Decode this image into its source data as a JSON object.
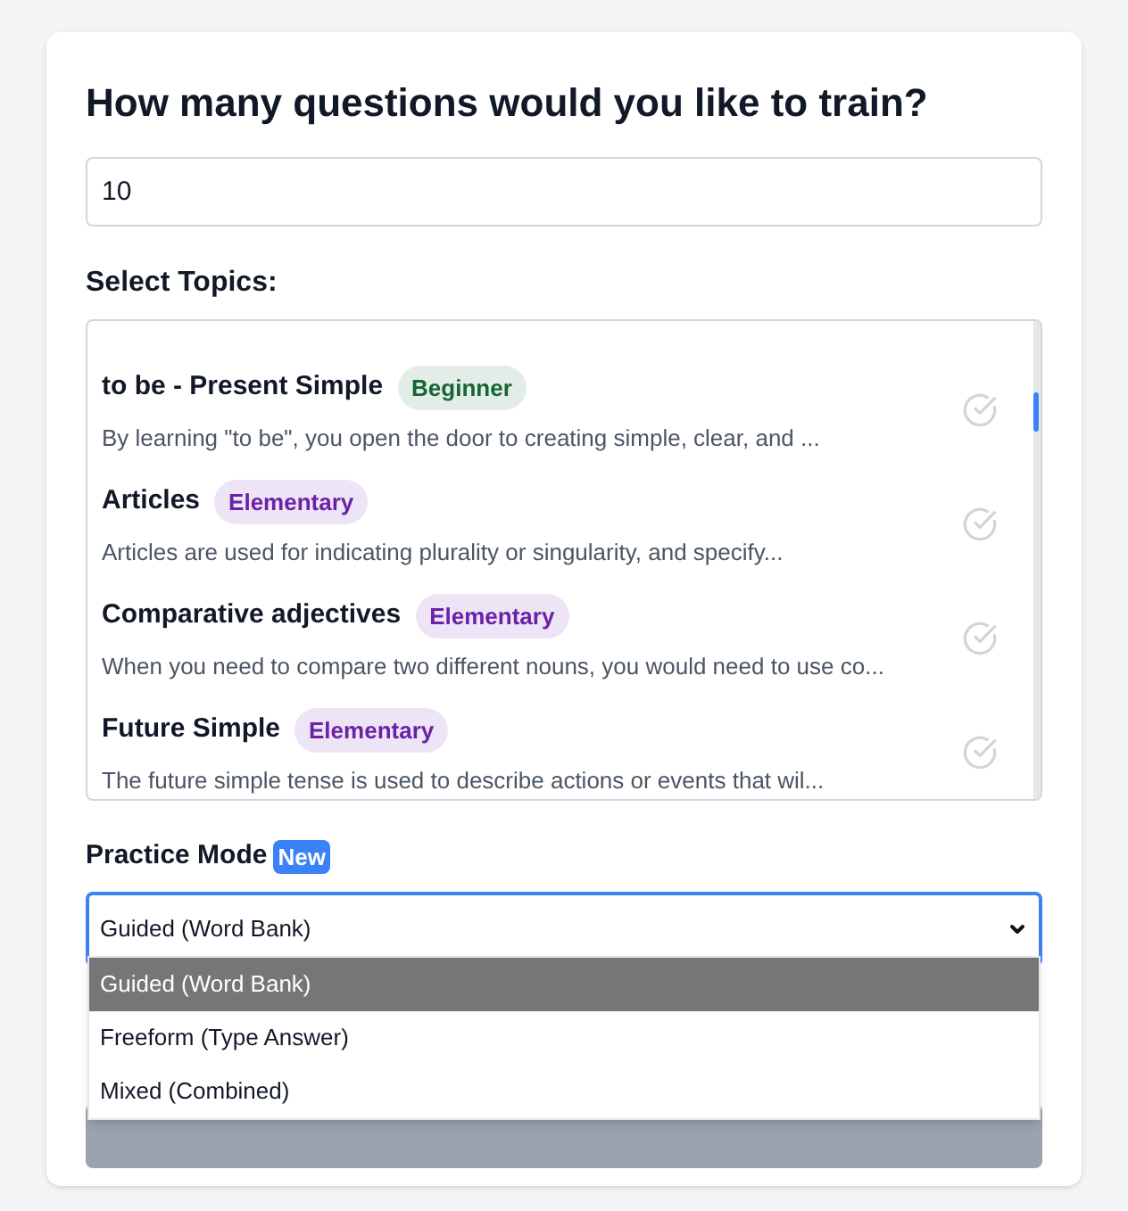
{
  "title": "How many questions would you like to train?",
  "question_count": {
    "value": "10"
  },
  "topics_label": "Select Topics:",
  "topics": [
    {
      "name": "to be - Present Simple",
      "badge": {
        "label": "Beginner",
        "color": "#166534"
      },
      "description": "By learning \"to be\", you open the door to creating simple, clear, and ...",
      "selected": false
    },
    {
      "name": "Articles",
      "badge": {
        "label": "Elementary",
        "color": "#6b21a8"
      },
      "description": "Articles are used for indicating plurality or singularity, and specify...",
      "selected": false
    },
    {
      "name": "Comparative adjectives",
      "badge": {
        "label": "Elementary",
        "color": "#6b21a8"
      },
      "description": "When you need to compare two different nouns, you would need to use co...",
      "selected": false
    },
    {
      "name": "Future Simple",
      "badge": {
        "label": "Elementary",
        "color": "#6b21a8"
      },
      "description": "The future simple tense is used to describe actions or events that wil...",
      "selected": false
    }
  ],
  "practice_mode": {
    "label": "Practice Mode",
    "badge": "New",
    "value": "Guided (Word Bank)",
    "expanded": true,
    "options": [
      {
        "label": "Guided (Word Bank)",
        "selected": true
      },
      {
        "label": "Freeform (Type Answer)",
        "selected": false
      },
      {
        "label": "Mixed (Combined)",
        "selected": false
      }
    ]
  },
  "start_button": {
    "disabled": true
  }
}
